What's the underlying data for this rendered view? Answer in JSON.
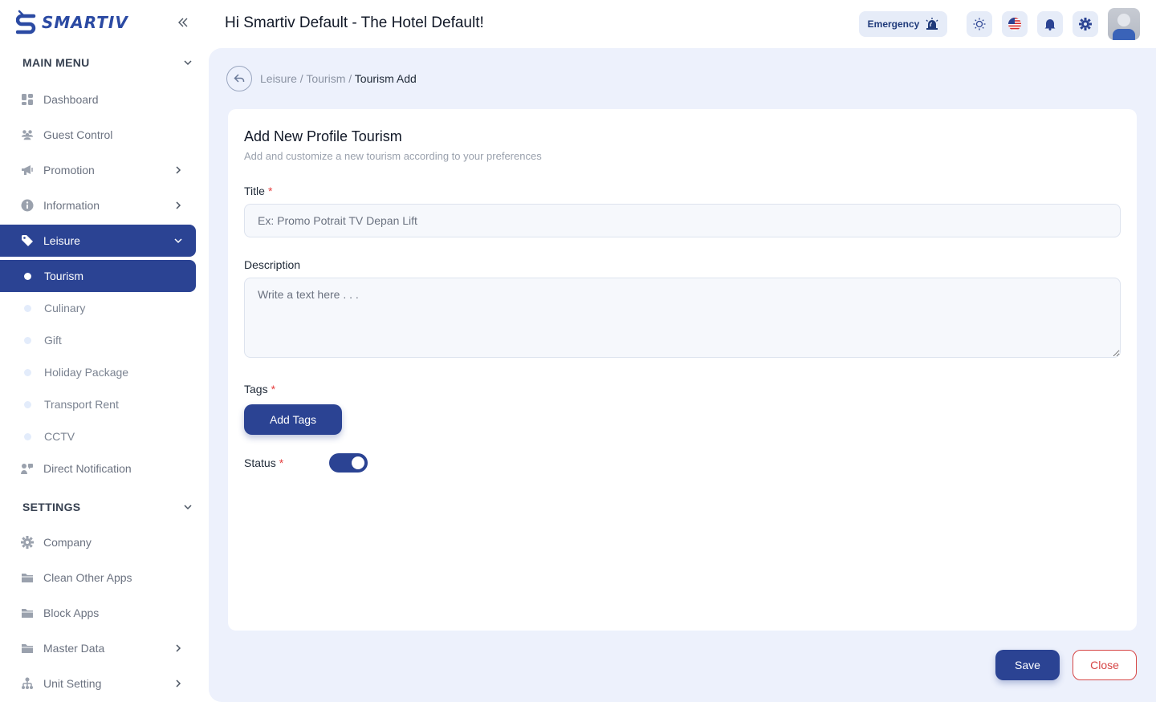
{
  "app": {
    "logo_text": "SMARTIV"
  },
  "header": {
    "greeting": "Hi Smartiv Default - The Hotel Default!",
    "emergency_label": "Emergency"
  },
  "sidebar": {
    "main_menu_label": "MAIN MENU",
    "settings_label": "SETTINGS",
    "main_items": [
      {
        "label": "Dashboard",
        "icon": "dashboard-icon"
      },
      {
        "label": "Guest Control",
        "icon": "users-icon"
      },
      {
        "label": "Promotion",
        "icon": "megaphone-icon"
      },
      {
        "label": "Information",
        "icon": "info-icon"
      },
      {
        "label": "Leisure",
        "icon": "tag-icon"
      },
      {
        "label": "Direct Notification",
        "icon": "notification-icon"
      }
    ],
    "leisure_sub": [
      {
        "label": "Tourism"
      },
      {
        "label": "Culinary"
      },
      {
        "label": "Gift"
      },
      {
        "label": "Holiday Package"
      },
      {
        "label": "Transport Rent"
      },
      {
        "label": "CCTV"
      }
    ],
    "settings_items": [
      {
        "label": "Company",
        "icon": "gear-icon"
      },
      {
        "label": "Clean Other Apps",
        "icon": "folder-icon"
      },
      {
        "label": "Block Apps",
        "icon": "folder-icon"
      },
      {
        "label": "Master Data",
        "icon": "folder-icon"
      },
      {
        "label": "Unit Setting",
        "icon": "sitemap-icon"
      }
    ]
  },
  "breadcrumb": {
    "part1": "Leisure",
    "sep": " / ",
    "part2": "Tourism",
    "current": "Tourism Add"
  },
  "form": {
    "title": "Add New Profile Tourism",
    "subtitle": "Add and customize a new tourism according to your preferences",
    "title_label": "Title",
    "title_placeholder": "Ex: Promo Potrait TV Depan Lift",
    "description_label": "Description",
    "description_placeholder": "Write a text here . . .",
    "tags_label": "Tags",
    "add_tags_label": "Add Tags",
    "status_label": "Status",
    "required_mark": "*",
    "status_on": true
  },
  "actions": {
    "save_label": "Save",
    "close_label": "Close"
  },
  "colors": {
    "primary": "#2b4393",
    "background": "#edf1fc",
    "danger": "#d64545"
  }
}
